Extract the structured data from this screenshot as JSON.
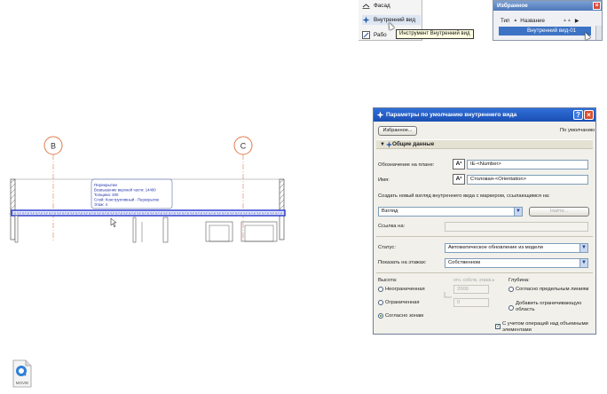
{
  "menu": {
    "items": [
      {
        "label": "Фасад",
        "icon": "elevation-icon"
      },
      {
        "label": "Внутренний вид",
        "icon": "interior-view-icon"
      },
      {
        "label": "Рабо",
        "icon": "worksheet-icon"
      }
    ],
    "tooltip": "Инструмент Внутренний вид"
  },
  "favorites": {
    "title": "Избранное",
    "col_type": "Тип",
    "col_name": "Название",
    "item": "Внутренний вид-01"
  },
  "drawing": {
    "axis_b": "B",
    "axis_c": "C",
    "info_label": {
      "title": "Перекрытие",
      "line1": "Возвышение верхней части: 14400",
      "line2": "Толщина: 300",
      "line3": "Слой: Конструктивный - Перекрытие",
      "line4": "Этаж: 4"
    }
  },
  "dialog": {
    "title": "Параметры по умолчанию внутреннего вида",
    "favorites_button": "Избранное...",
    "default_label": "По умолчанию",
    "section_title": "Общие данные",
    "plan_id_label": "Обозначение на плане:",
    "plan_id_value": "IE-<Number>",
    "name_label": "Имя:",
    "name_value": "Столовая-<Orientation>",
    "create_label": "Создать новый взгляд внутреннего вида с маркером, ссылающимся на:",
    "create_value": "Взгляд",
    "find_button": "Найти...",
    "ref_label": "Ссылка на:",
    "status_label": "Статус:",
    "status_value": "Автоматическое обновление из модели",
    "show_on_label": "Показать на этажах:",
    "show_on_value": "Собственном",
    "height_label": "Высота:",
    "height_sub": "отн. собств. этажа",
    "radio_unlimited": "Неограниченная",
    "radio_limited": "Ограниченная",
    "radio_zones": "Согласно зонам",
    "height_value_1": "2000",
    "height_value_2": "0",
    "depth_label": "Глубина:",
    "depth_by_lines": "Согласно предельным линиям",
    "depth_add_area": "Добавить ограничивающую область",
    "check_ops": "С учетом операций над объемными элементами"
  },
  "movie_icon": {
    "label": "MOVIE"
  }
}
